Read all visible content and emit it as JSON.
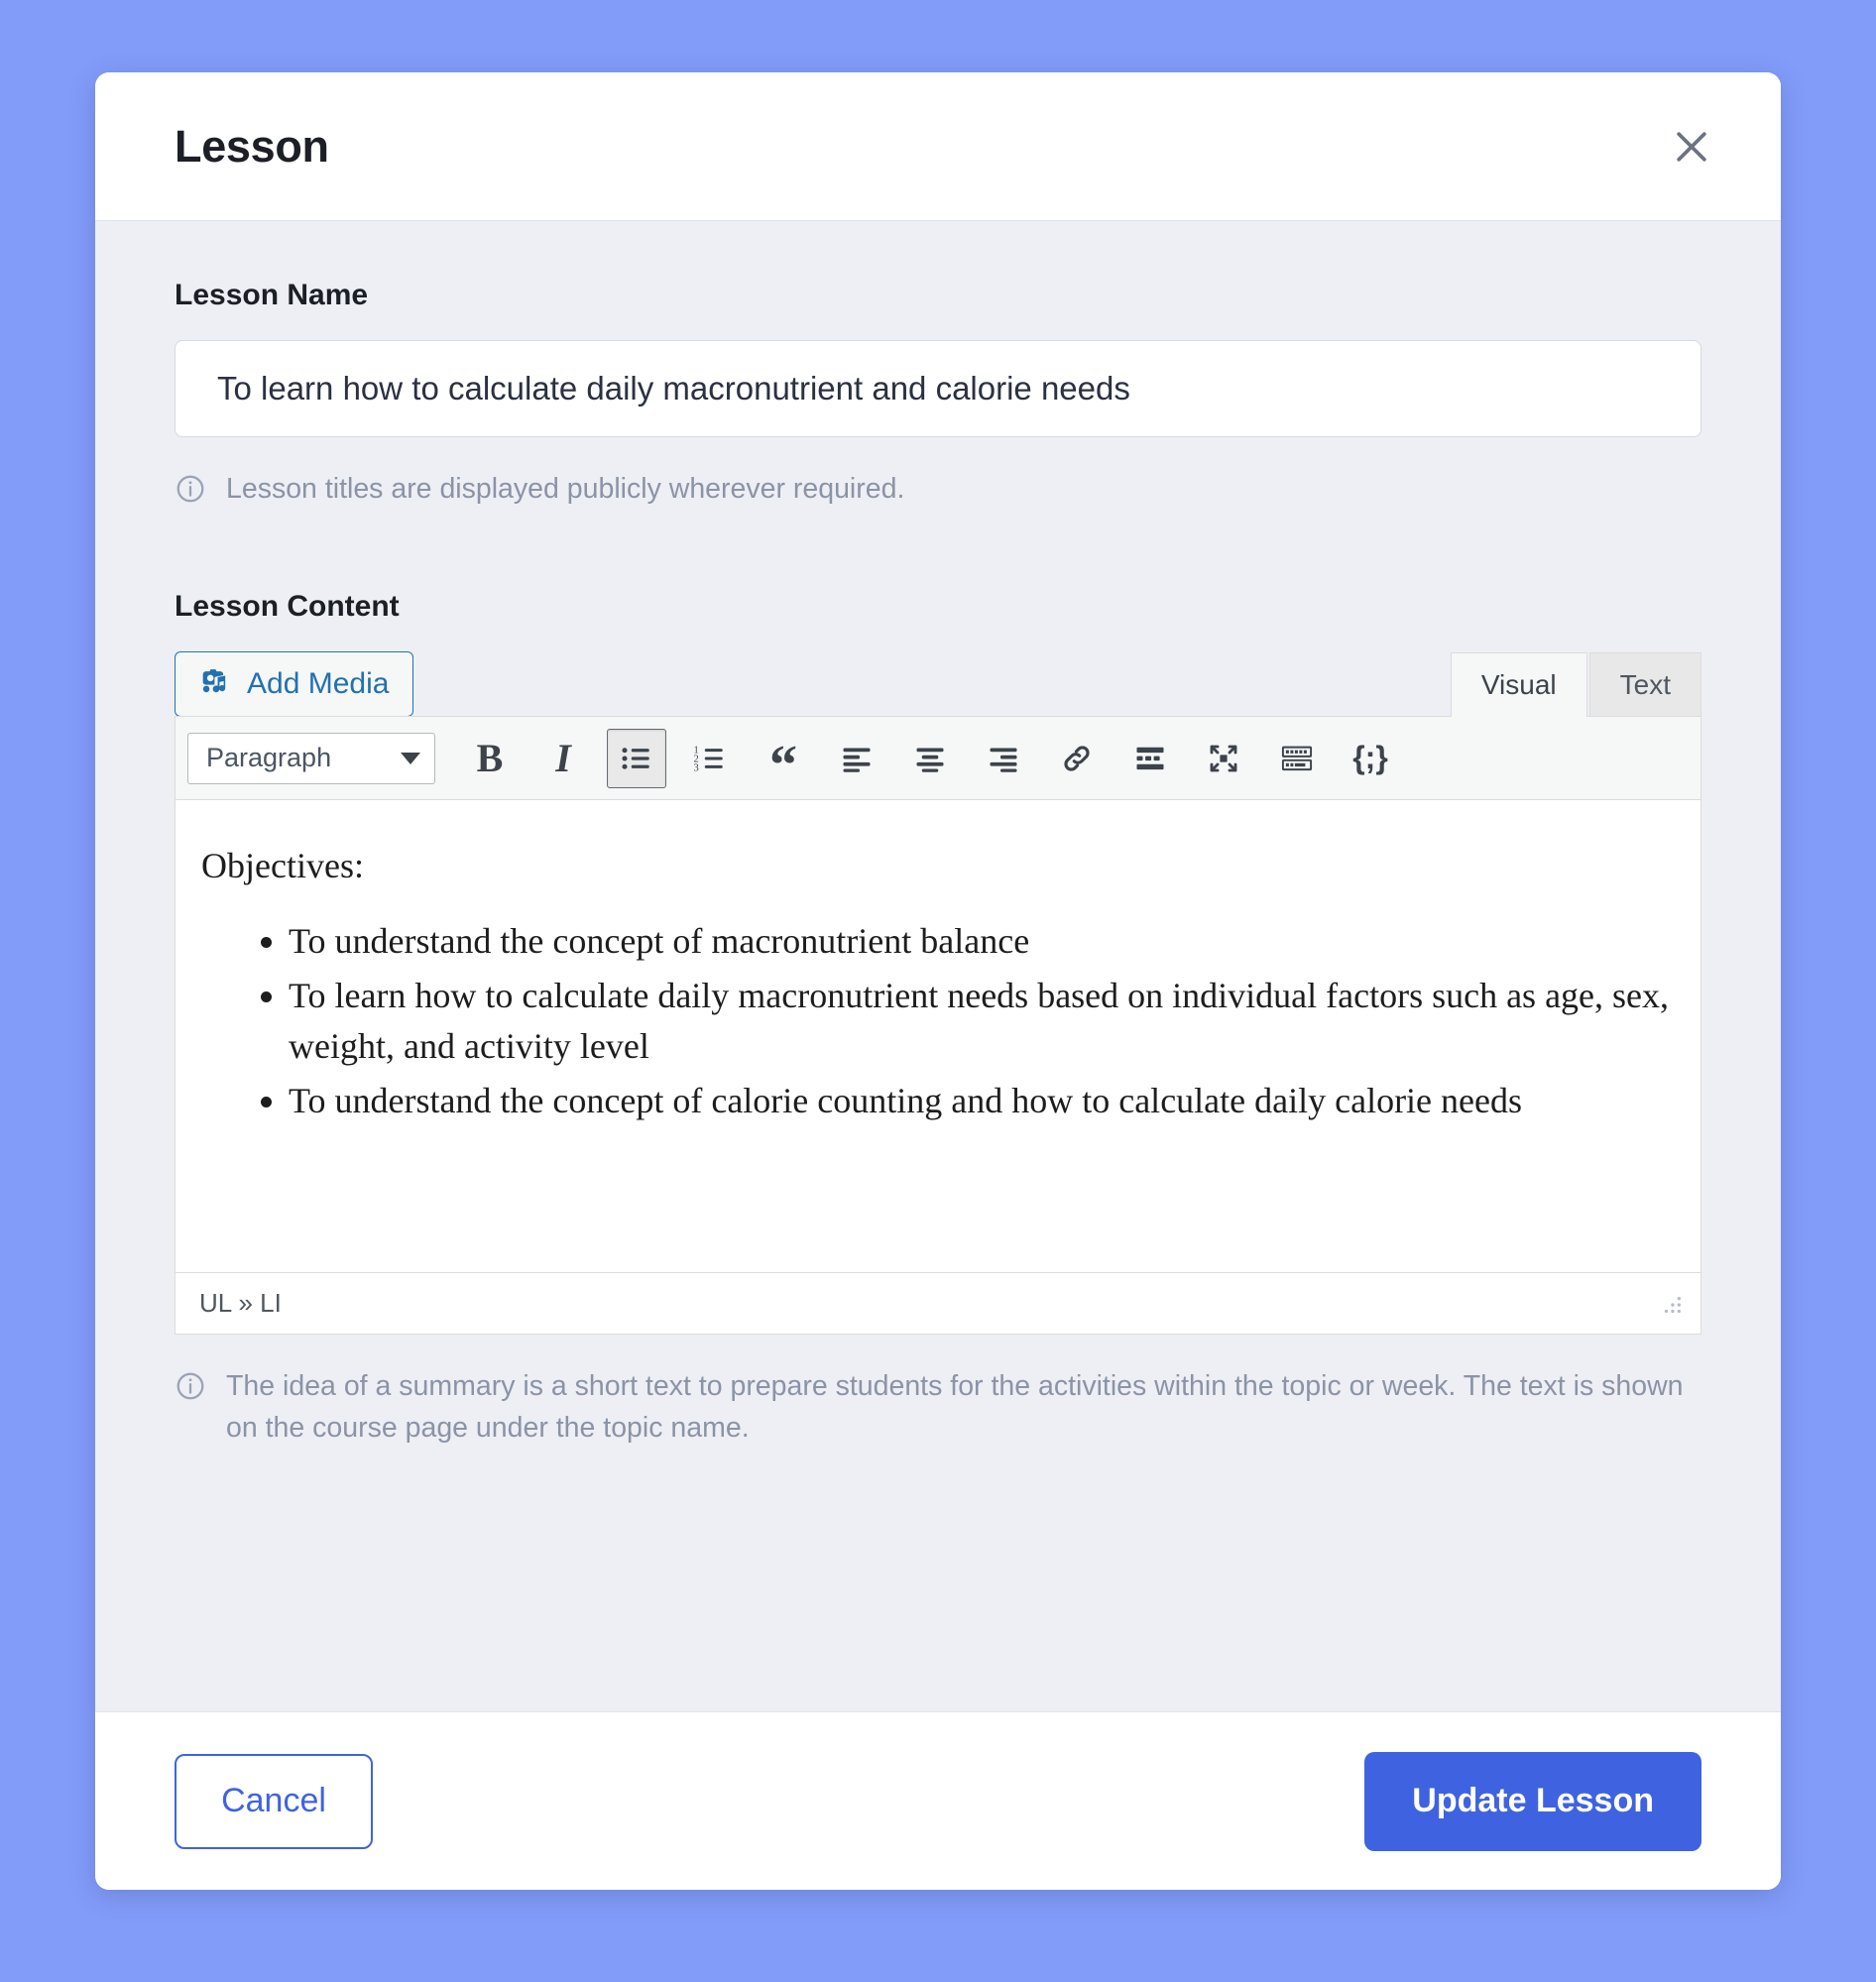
{
  "modal": {
    "title": "Lesson",
    "close_icon": "close-icon"
  },
  "lesson_name": {
    "label": "Lesson Name",
    "value": "To learn how to calculate daily macronutrient and calorie needs",
    "placeholder": "Lesson Name",
    "hint": "Lesson titles are displayed publicly wherever required.",
    "hint_icon": "info-circle-icon"
  },
  "lesson_content": {
    "label": "Lesson Content",
    "add_media_label": "Add Media",
    "add_media_icon": "camera-music-media-icon",
    "tabs": [
      {
        "label": "Visual",
        "active": true
      },
      {
        "label": "Text",
        "active": false
      }
    ],
    "toolbar": {
      "format_select": "Paragraph",
      "format_caret_icon": "chevron-down-icon",
      "buttons": [
        {
          "name": "bold-icon",
          "label": "B",
          "active": false
        },
        {
          "name": "italic-icon",
          "label": "I",
          "active": false
        },
        {
          "name": "bulleted-list-icon",
          "label": "",
          "active": true
        },
        {
          "name": "numbered-list-icon",
          "label": "",
          "active": false
        },
        {
          "name": "blockquote-icon",
          "label": "“",
          "active": false
        },
        {
          "name": "align-left-icon",
          "label": "",
          "active": false
        },
        {
          "name": "align-center-icon",
          "label": "",
          "active": false
        },
        {
          "name": "align-right-icon",
          "label": "",
          "active": false
        },
        {
          "name": "insert-link-icon",
          "label": "",
          "active": false
        },
        {
          "name": "insert-read-more-icon",
          "label": "",
          "active": false
        },
        {
          "name": "fullscreen-icon",
          "label": "",
          "active": false
        },
        {
          "name": "toolbar-toggle-keyboard-icon",
          "label": "",
          "active": false
        },
        {
          "name": "source-code-icon",
          "label": "{;}",
          "active": false
        }
      ]
    },
    "body": {
      "intro": "Objectives:",
      "bullets": [
        "To understand the concept of macronutrient balance",
        "To learn how to calculate daily macronutrient needs based on individual factors such as age, sex, weight, and activity level",
        "To understand the concept of calorie counting and how to calculate daily calorie needs"
      ]
    },
    "status_path": "UL » LI",
    "resize_handle_icon": "resize-grip-icon",
    "hint": "The idea of a summary is a short text to prepare students for the activities within the topic or week. The text is shown on the course page under the topic name.",
    "hint_icon": "info-circle-icon"
  },
  "footer": {
    "cancel_label": "Cancel",
    "submit_label": "Update Lesson"
  },
  "colors": {
    "page_background": "#829CFA",
    "modal_body": "#EDEFF4",
    "primary": "#3F63E0",
    "wp_link_blue": "#2271B1",
    "muted_text": "#8B93A6"
  }
}
